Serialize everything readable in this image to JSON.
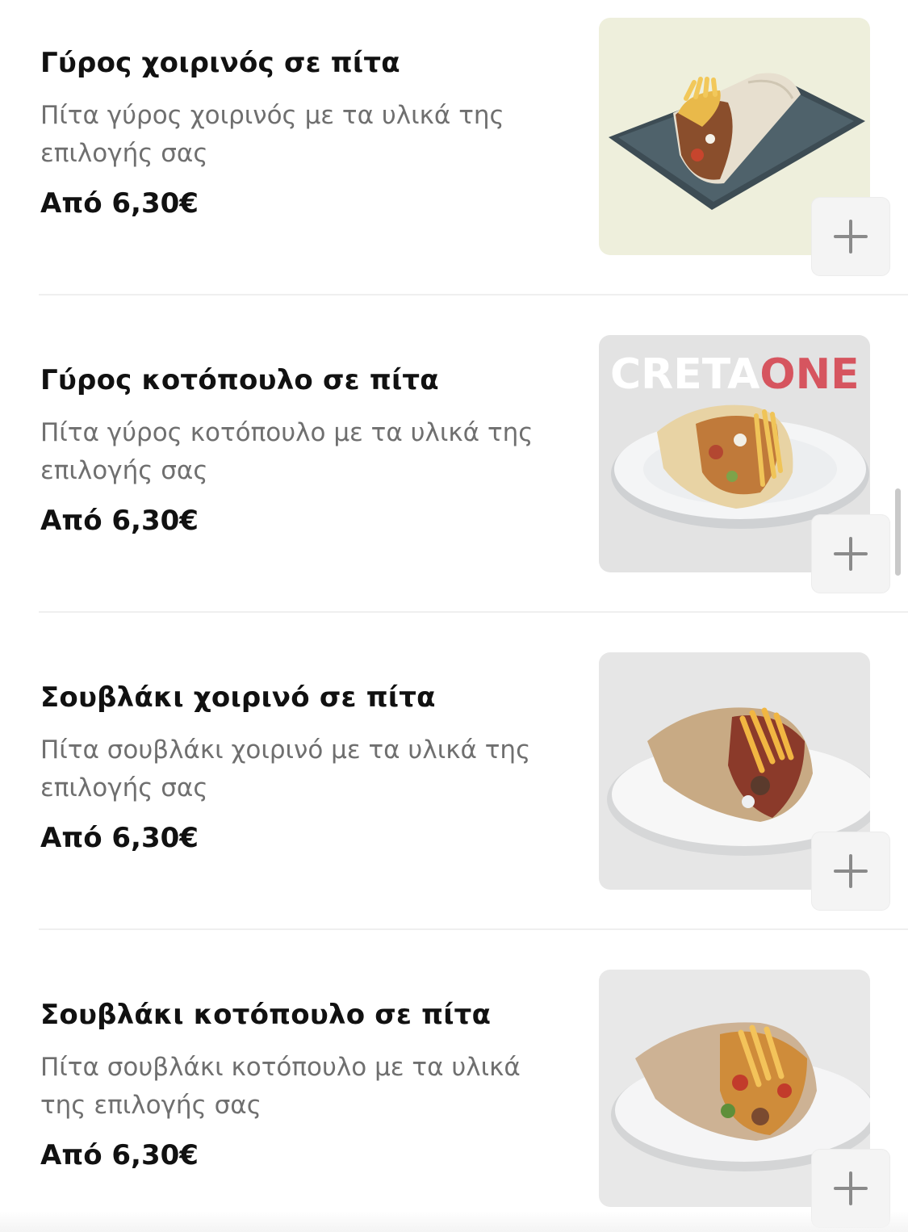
{
  "menu": {
    "items": [
      {
        "title": "Γύρος χοιρινός σε πίτα",
        "description": "Πίτα γύρος χοιρινός με τα υλικά της επιλογής σας",
        "price": "Από 6,30€",
        "image": "pork-gyros-pita-photo",
        "image_background": "#eeefdc"
      },
      {
        "title": "Γύρος κοτόπουλο σε πίτα",
        "description": "Πίτα γύρος κοτόπουλο με τα υλικά της επιλογής σας",
        "price": "Από 6,30€",
        "image": "chicken-gyros-pita-photo",
        "image_background": "#e3e3e3",
        "image_brand": {
          "part1": "CRETA",
          "part2": "ONE",
          "color1": "#ffffff",
          "color2": "#d6555f"
        }
      },
      {
        "title": "Σουβλάκι χοιρινό σε πίτα",
        "description": "Πίτα σουβλάκι χοιρινό με τα υλικά της επιλογής σας",
        "price": "Από 6,30€",
        "image": "pork-souvlaki-pita-photo",
        "image_background": "#e6e6e6"
      },
      {
        "title": "Σουβλάκι κοτόπουλο σε πίτα",
        "description": "Πίτα σουβλάκι κοτόπουλο με τα υλικά της επιλογής σας",
        "price": "Από 6,30€",
        "image": "chicken-souvlaki-pita-photo",
        "image_background": "#e8e8e8"
      }
    ]
  },
  "add_button": {
    "icon": "plus-icon",
    "color": "#8a8a8a"
  }
}
